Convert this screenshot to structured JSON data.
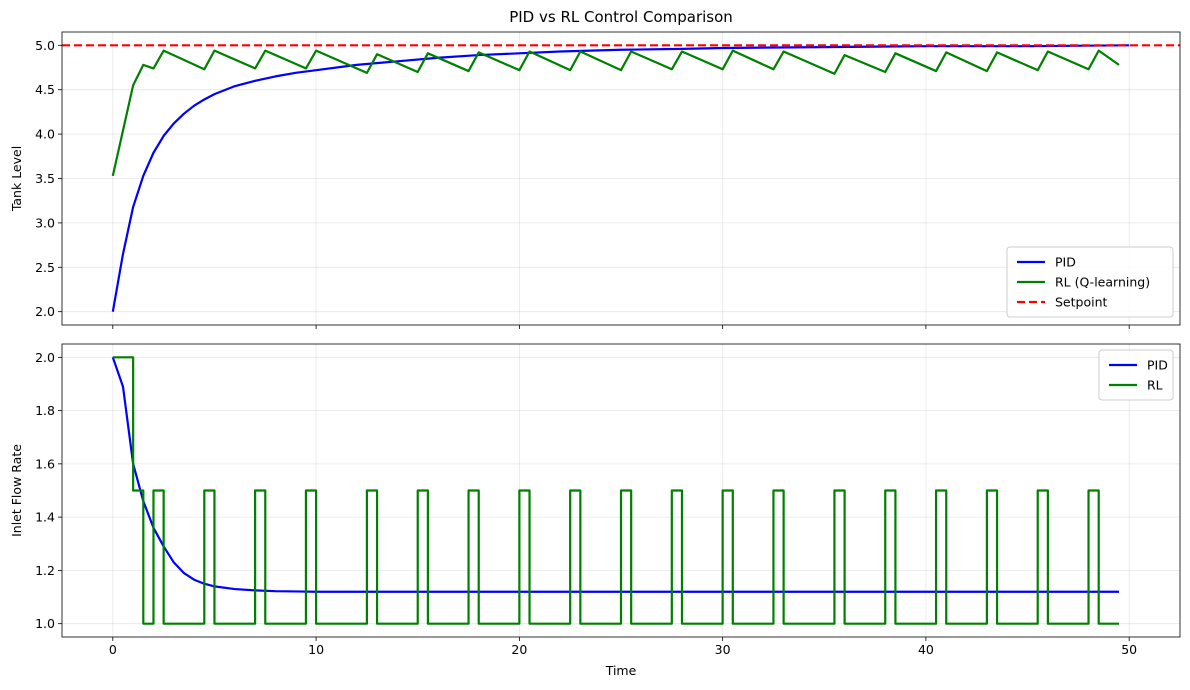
{
  "chart_data": [
    {
      "type": "line",
      "title": "PID vs RL Control Comparison",
      "xlabel": "",
      "ylabel": "Tank Level",
      "xlim": [
        -2.5,
        52.5
      ],
      "ylim": [
        1.85,
        5.15
      ],
      "xticks": [
        0,
        10,
        20,
        30,
        40,
        50
      ],
      "xtick_labels_shown": false,
      "yticks": [
        2.0,
        2.5,
        3.0,
        3.5,
        4.0,
        4.5,
        5.0
      ],
      "grid": true,
      "legend_position": "lower-right",
      "series": [
        {
          "name": "PID",
          "color": "#0000ff",
          "style": "solid",
          "x": [
            0,
            0.5,
            1,
            1.5,
            2,
            2.5,
            3,
            3.5,
            4,
            4.5,
            5,
            6,
            7,
            8,
            9,
            10,
            12,
            14,
            16,
            18,
            20,
            22,
            25,
            28,
            30,
            35,
            40,
            45,
            50
          ],
          "y": [
            2.0,
            2.65,
            3.18,
            3.53,
            3.79,
            3.98,
            4.12,
            4.23,
            4.32,
            4.39,
            4.45,
            4.54,
            4.6,
            4.65,
            4.69,
            4.72,
            4.78,
            4.82,
            4.86,
            4.89,
            4.91,
            4.93,
            4.95,
            4.96,
            4.97,
            4.98,
            4.99,
            4.99,
            5.0
          ]
        },
        {
          "name": "RL (Q-learning)",
          "color": "#008000",
          "style": "solid",
          "x": [
            0,
            1,
            1.5,
            2,
            2.5,
            4.5,
            5,
            7,
            7.5,
            9.5,
            10,
            12.5,
            13,
            15,
            15.5,
            17.5,
            18,
            20,
            20.5,
            22.5,
            23,
            25,
            25.5,
            27.5,
            28,
            30,
            30.5,
            32.5,
            33,
            35.5,
            36,
            38,
            38.5,
            40.5,
            41,
            43,
            43.5,
            45.5,
            46,
            48,
            48.5,
            49.5
          ],
          "y": [
            3.53,
            4.55,
            4.78,
            4.74,
            4.94,
            4.73,
            4.94,
            4.74,
            4.94,
            4.74,
            4.94,
            4.69,
            4.9,
            4.7,
            4.91,
            4.71,
            4.92,
            4.72,
            4.93,
            4.72,
            4.93,
            4.72,
            4.93,
            4.73,
            4.93,
            4.73,
            4.94,
            4.73,
            4.93,
            4.68,
            4.89,
            4.7,
            4.91,
            4.71,
            4.92,
            4.71,
            4.92,
            4.72,
            4.93,
            4.73,
            4.94,
            4.78
          ]
        },
        {
          "name": "Setpoint",
          "color": "#ff0000",
          "style": "dashed",
          "x": [
            -2.5,
            52.5
          ],
          "y": [
            5.0,
            5.0
          ]
        }
      ]
    },
    {
      "type": "line",
      "title": "",
      "xlabel": "Time",
      "ylabel": "Inlet Flow Rate",
      "xlim": [
        -2.5,
        52.5
      ],
      "ylim": [
        0.95,
        2.05
      ],
      "xticks": [
        0,
        10,
        20,
        30,
        40,
        50
      ],
      "xtick_labels_shown": true,
      "yticks": [
        1.0,
        1.2,
        1.4,
        1.6,
        1.8,
        2.0
      ],
      "grid": true,
      "legend_position": "upper-right",
      "series": [
        {
          "name": "PID",
          "color": "#0000ff",
          "style": "solid",
          "x": [
            0,
            0.5,
            1,
            1.5,
            2,
            2.5,
            3,
            3.5,
            4,
            4.5,
            5,
            6,
            7,
            8,
            9,
            10,
            12,
            15,
            20,
            25,
            30,
            35,
            40,
            45,
            49.5
          ],
          "y": [
            2.0,
            1.89,
            1.6,
            1.46,
            1.36,
            1.29,
            1.23,
            1.19,
            1.165,
            1.15,
            1.14,
            1.13,
            1.125,
            1.122,
            1.121,
            1.12,
            1.12,
            1.12,
            1.12,
            1.12,
            1.12,
            1.12,
            1.12,
            1.12,
            1.12
          ]
        },
        {
          "name": "RL",
          "color": "#008000",
          "style": "step",
          "x": [
            0,
            1,
            1.5,
            2,
            2.5,
            4.5,
            5,
            7,
            7.5,
            9.5,
            10,
            12.5,
            13,
            15,
            15.5,
            17.5,
            18,
            20,
            20.5,
            22.5,
            23,
            25,
            25.5,
            27.5,
            28,
            30,
            30.5,
            32.5,
            33,
            35.5,
            36,
            38,
            38.5,
            40.5,
            41,
            43,
            43.5,
            45.5,
            46,
            48,
            48.5,
            49.5
          ],
          "y": [
            2.0,
            1.5,
            1.0,
            1.5,
            1.0,
            1.5,
            1.0,
            1.5,
            1.0,
            1.5,
            1.0,
            1.5,
            1.0,
            1.5,
            1.0,
            1.5,
            1.0,
            1.5,
            1.0,
            1.5,
            1.0,
            1.5,
            1.0,
            1.5,
            1.0,
            1.5,
            1.0,
            1.5,
            1.0,
            1.5,
            1.0,
            1.5,
            1.0,
            1.5,
            1.0,
            1.5,
            1.0,
            1.5,
            1.0,
            1.5,
            1.0,
            1.0
          ]
        }
      ]
    }
  ]
}
